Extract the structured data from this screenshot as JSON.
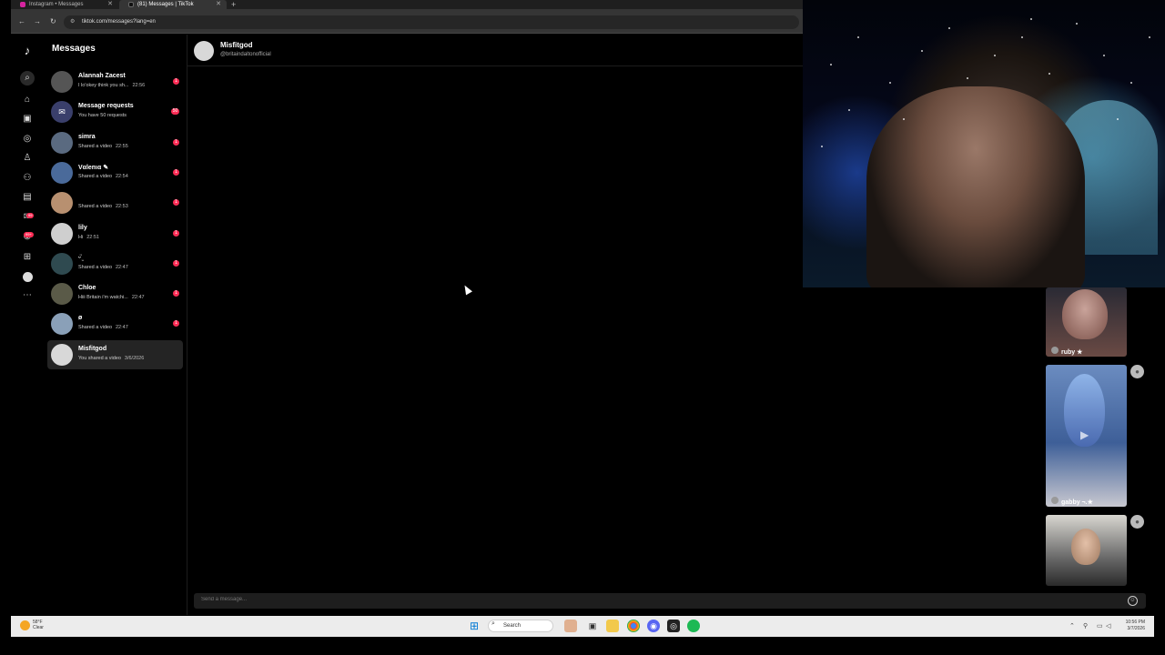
{
  "browser": {
    "tabs": [
      {
        "label": "Instagram • Messages",
        "active": false
      },
      {
        "label": "(81) Messages | TikTok",
        "active": true
      }
    ],
    "new_tab": "+",
    "url": "tiktok.com/messages?lang=en"
  },
  "rail": {
    "icons": [
      "tiktok-logo-icon",
      "search-icon",
      "home-icon",
      "shop-icon",
      "explore-icon",
      "following-icon",
      "friends-icon",
      "live-icon",
      "messages-icon",
      "activity-icon",
      "upload-icon",
      "profile-icon",
      "more-icon"
    ],
    "badge_messages": "99",
    "badge_activity": "99+"
  },
  "messages": {
    "title": "Messages",
    "conversations": [
      {
        "name": "Alannah Zacest",
        "preview": "I lo'okey think you sh...",
        "time": "22:56",
        "unread": "1",
        "avatar_color": "#555555"
      },
      {
        "name": "Message requests",
        "preview": "You have 50 requests",
        "time": "",
        "unread": "50",
        "avatar_color": "#3a3f6b"
      },
      {
        "name": "simra",
        "preview": "Shared a video",
        "time": "22:55",
        "unread": "1",
        "avatar_color": "#5a6a80"
      },
      {
        "name": "Vαleпια ✎",
        "preview": "Shared a video",
        "time": "22:54",
        "unread": "1",
        "avatar_color": "#4a6a9a"
      },
      {
        "name": "",
        "preview": "Shared a video",
        "time": "22:53",
        "unread": "1",
        "avatar_color": "#b89070"
      },
      {
        "name": "lily",
        "preview": "Hi",
        "time": "22:51",
        "unread": "1",
        "avatar_color": "#cfcfcf"
      },
      {
        "name": "ᵕ̈ ̫",
        "preview": "Shared a video",
        "time": "22:47",
        "unread": "1",
        "avatar_color": "#2f4a50"
      },
      {
        "name": "Chloe",
        "preview": "Hiii Britain i'm watchi...",
        "time": "22:47",
        "unread": "1",
        "avatar_color": "#5a5a48"
      },
      {
        "name": "ø",
        "preview": "Shared a video",
        "time": "22:47",
        "unread": "1",
        "avatar_color": "#8aa0b8"
      },
      {
        "name": "Misfitgod",
        "preview": "You shared a video",
        "time": "3/6/2026",
        "unread": "",
        "avatar_color": "#d8d8d8",
        "active": true
      }
    ]
  },
  "chat": {
    "name": "Misfitgod",
    "handle": "@britaindaltonofficial",
    "input_placeholder": "Send a message...",
    "emoji_icon": "☺"
  },
  "reels": [
    {
      "label": "ruby ★"
    },
    {
      "label": "gabby ¬.★"
    },
    {
      "label": ""
    }
  ],
  "taskbar": {
    "weather_temp": "58°F",
    "weather_desc": "Clear",
    "search_label": "Search",
    "time": "10:56 PM",
    "date": "3/7/2026"
  },
  "colors": {
    "accent": "#fe2c55",
    "background": "#000000",
    "active_row": "#242424"
  }
}
